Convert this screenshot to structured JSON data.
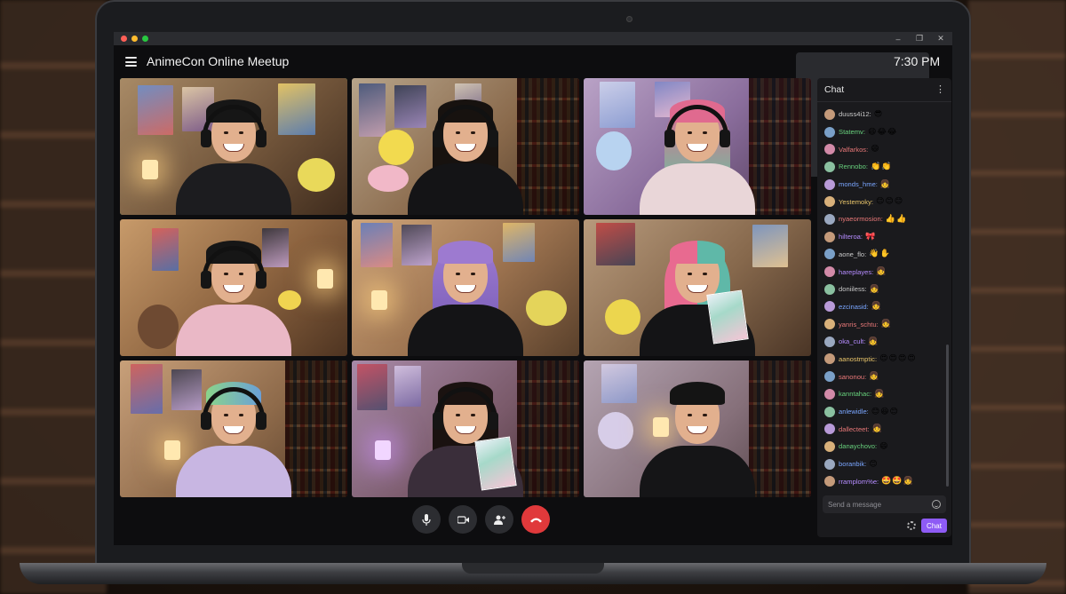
{
  "window": {
    "title": "AnimeCon Online Meetup",
    "time": "7:30 PM",
    "controls": [
      "–",
      "❐",
      "✕"
    ]
  },
  "header_icons": {
    "video": "video-camera-icon",
    "participants": "person-icon",
    "menu": "hamburger-menu-icon"
  },
  "call_controls": {
    "mic": "microphone-icon",
    "camera": "video-camera-icon",
    "add_person": "add-person-icon",
    "hang_up": "hang-up-phone-icon",
    "hang_up_color": "#e0393b"
  },
  "participants_count": 9,
  "chat": {
    "title": "Chat",
    "input_placeholder": "Send a message",
    "send_label": "Chat",
    "accent_color": "#8e5bf5",
    "messages": [
      {
        "user": "duuss4i12:",
        "color": "#c9c9c9",
        "emoji": "😎"
      },
      {
        "user": "Statemv:",
        "color": "#67d07c",
        "emoji": "😄😂😂"
      },
      {
        "user": "Valfarkos:",
        "color": "#e87878",
        "emoji": "😄"
      },
      {
        "user": "Rennobo:",
        "color": "#67d07c",
        "emoji": "👏👏"
      },
      {
        "user": "monds_hme:",
        "color": "#7aa6ff",
        "emoji": "👧"
      },
      {
        "user": "Yestemoky:",
        "color": "#e8c46a",
        "emoji": "😊😊😊"
      },
      {
        "user": "nyaeormosion:",
        "color": "#e87878",
        "emoji": "👍👍"
      },
      {
        "user": "hilteroa:",
        "color": "#b58cff",
        "emoji": "🎀"
      },
      {
        "user": "aone_flo:",
        "color": "#c9c9c9",
        "emoji": "👋✋"
      },
      {
        "user": "hareplayes:",
        "color": "#b58cff",
        "emoji": "👧"
      },
      {
        "user": "doniiless:",
        "color": "#c9c9c9",
        "emoji": "👧"
      },
      {
        "user": "ezcinasid:",
        "color": "#7aa6ff",
        "emoji": "👧"
      },
      {
        "user": "yanris_schtu:",
        "color": "#e87878",
        "emoji": "👧"
      },
      {
        "user": "oka_cult:",
        "color": "#b58cff",
        "emoji": "👧"
      },
      {
        "user": "aanostmptic:",
        "color": "#e8c46a",
        "emoji": "😍😍😍😍"
      },
      {
        "user": "sanonou:",
        "color": "#e87878",
        "emoji": "👧"
      },
      {
        "user": "kanntahac:",
        "color": "#67d07c",
        "emoji": "👧"
      },
      {
        "user": "anlewidle:",
        "color": "#7aa6ff",
        "emoji": "😊😆😊"
      },
      {
        "user": "dallecteet:",
        "color": "#e87878",
        "emoji": "👧"
      },
      {
        "user": "danaychovo:",
        "color": "#67d07c",
        "emoji": "😄"
      },
      {
        "user": "boranbik:",
        "color": "#7aa6ff",
        "emoji": "😊"
      },
      {
        "user": "rramplom%e:",
        "color": "#b58cff",
        "emoji": "🤩🤩👧"
      }
    ]
  }
}
